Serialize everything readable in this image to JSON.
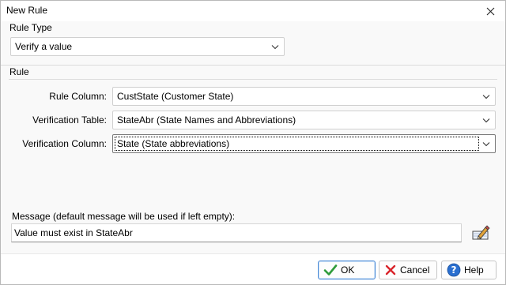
{
  "window": {
    "title": "New Rule"
  },
  "rule_type": {
    "group_label": "Rule Type",
    "selected": "Verify a value"
  },
  "rule": {
    "group_label": "Rule",
    "rule_column": {
      "label": "Rule Column:",
      "value": "CustState  (Customer State)"
    },
    "verification_table": {
      "label": "Verification Table:",
      "value": "StateAbr  (State Names and Abbreviations)"
    },
    "verification_column": {
      "label": "Verification Column:",
      "value": "State  (State abbreviations)"
    }
  },
  "message": {
    "label": "Message (default message will be used if left empty):",
    "value": "Value must exist in StateAbr"
  },
  "buttons": {
    "ok": "OK",
    "cancel": "Cancel",
    "help": "Help"
  },
  "colors": {
    "ok_check": "#2e9c3a",
    "cancel_x": "#d9242b",
    "help_circle": "#2a6fd0"
  }
}
